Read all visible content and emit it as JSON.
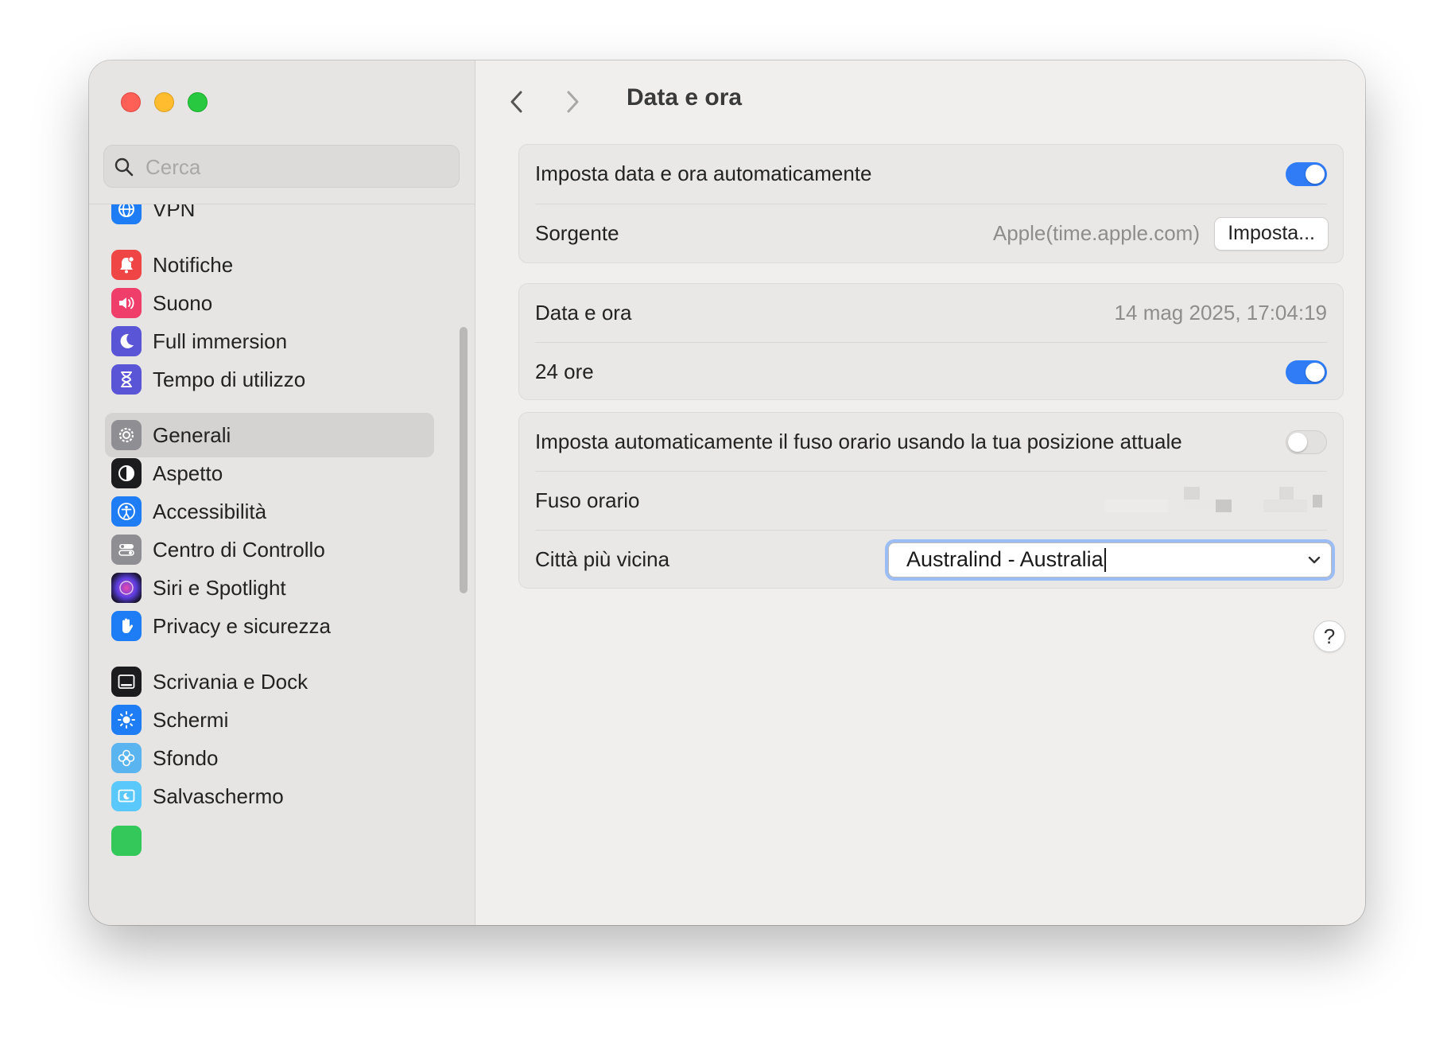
{
  "search": {
    "placeholder": "Cerca"
  },
  "sidebar": {
    "items": [
      {
        "label": "VPN",
        "icon": "globe-icon",
        "color": "#1e7cf5"
      },
      {
        "label": "Notifiche",
        "icon": "bell-icon",
        "color": "#f04545"
      },
      {
        "label": "Suono",
        "icon": "speaker-icon",
        "color": "#f03e6a"
      },
      {
        "label": "Full immersion",
        "icon": "moon-icon",
        "color": "#5a55d6"
      },
      {
        "label": "Tempo di utilizzo",
        "icon": "hourglass-icon",
        "color": "#5a55d6"
      },
      {
        "label": "Generali",
        "icon": "gear-icon",
        "color": "#8e8e93",
        "selected": true
      },
      {
        "label": "Aspetto",
        "icon": "appearance-icon",
        "color": "#1c1c1e"
      },
      {
        "label": "Accessibilità",
        "icon": "accessibility-icon",
        "color": "#1e7cf5"
      },
      {
        "label": "Centro di Controllo",
        "icon": "toggles-icon",
        "color": "#8e8e93"
      },
      {
        "label": "Siri e Spotlight",
        "icon": "siri-icon",
        "color": "#2a1c4a"
      },
      {
        "label": "Privacy e sicurezza",
        "icon": "hand-icon",
        "color": "#1e7cf5"
      },
      {
        "label": "Scrivania e Dock",
        "icon": "dock-icon",
        "color": "#1c1c1e"
      },
      {
        "label": "Schermi",
        "icon": "sun-icon",
        "color": "#1e7cf5"
      },
      {
        "label": "Sfondo",
        "icon": "flower-icon",
        "color": "#5ab4f0"
      },
      {
        "label": "Salvaschermo",
        "icon": "screensaver-icon",
        "color": "#5ac8fa"
      }
    ]
  },
  "header": {
    "title": "Data e ora"
  },
  "group1": {
    "auto_label": "Imposta data e ora automaticamente",
    "auto_on": true,
    "source_label": "Sorgente",
    "source_value": "Apple(time.apple.com)",
    "source_button": "Imposta..."
  },
  "group2": {
    "datetime_label": "Data e ora",
    "datetime_value": "14 mag 2025, 17:04:19",
    "h24_label": "24 ore",
    "h24_on": true
  },
  "group3": {
    "auto_tz_label": "Imposta automaticamente il fuso orario usando la tua posizione attuale",
    "auto_tz_on": false,
    "tz_label": "Fuso orario",
    "city_label": "Città più vicina",
    "city_value": "Australind - Australia"
  },
  "help": {
    "label": "?"
  },
  "colors": {
    "accent": "#2f7cf6",
    "focus_ring": "#9bbdf5"
  }
}
